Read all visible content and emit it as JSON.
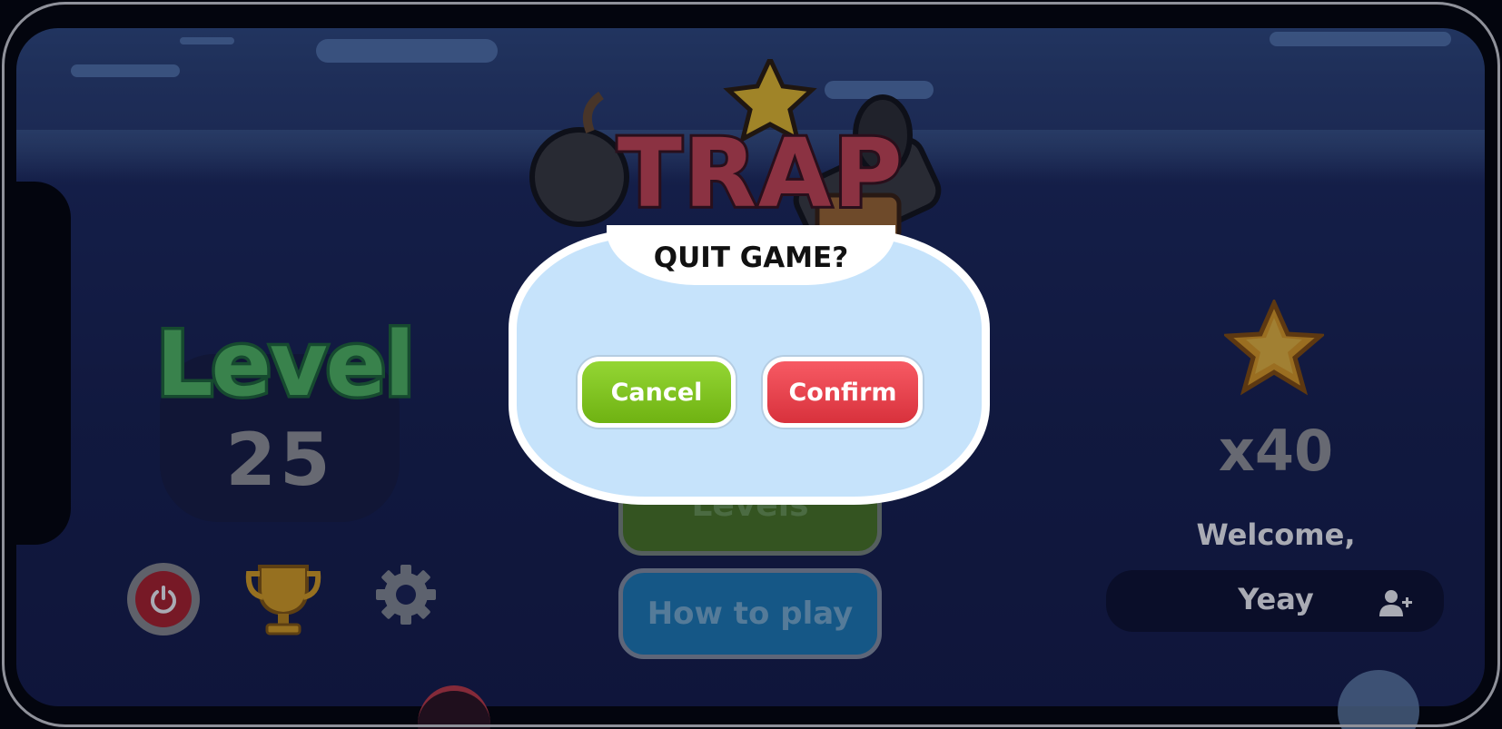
{
  "logo": {
    "text": "TRAP"
  },
  "level": {
    "title": "Level",
    "number": "25"
  },
  "menu": {
    "levels_label": "Levels",
    "how_to_play_label": "How to play"
  },
  "stars": {
    "count": "x40"
  },
  "user": {
    "welcome": "Welcome,",
    "name": "Yeay"
  },
  "dialog": {
    "title": "QUIT GAME?",
    "cancel_label": "Cancel",
    "confirm_label": "Confirm"
  },
  "colors": {
    "cancel": "#7fc11c",
    "confirm": "#e8414b",
    "level_title": "#53c060",
    "dialog_bg": "#c6e3fb"
  },
  "icons": [
    "power-icon",
    "trophy-icon",
    "gear-icon",
    "star-icon",
    "add-user-icon"
  ]
}
